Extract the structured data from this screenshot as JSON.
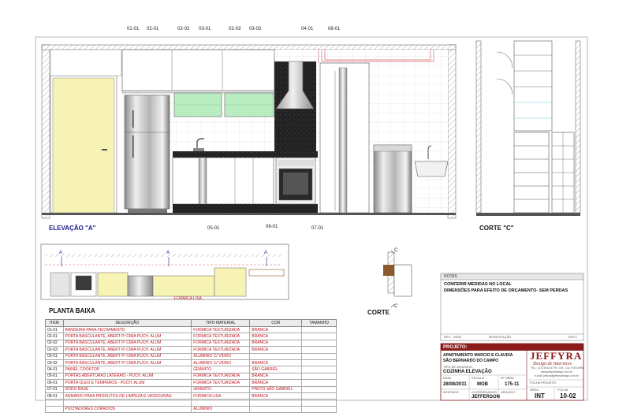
{
  "sheet": {
    "tags_top": [
      "01-01",
      "02-01",
      "02-02",
      "03-01",
      "02-03",
      "03-02",
      "04-01",
      "08-01"
    ],
    "tags_bottom": [
      "05-01",
      "06-01",
      "07-01"
    ],
    "corte_a_marks": [
      "A",
      "A",
      "A"
    ],
    "corte_c_marks": [
      "C",
      "C"
    ]
  },
  "views": {
    "elevation_a": "ELEVAÇÃO \"A\"",
    "corte_c": "CORTE \"C\"",
    "planta_baixa": "PLANTA BAIXA",
    "corte": "CORTE",
    "plan_label": "FORMICA LISA"
  },
  "materials_table": {
    "headers": [
      "ITEM",
      "DESCRIÇÃO",
      "TIPO MATERIAL",
      "COR",
      "TAMANHO"
    ],
    "rows": [
      [
        "01-01",
        "BANDEIRA PARA FECHAMENTO",
        "FORMICA TEXTURIZADA",
        "BRANCA",
        ""
      ],
      [
        "02-01",
        "PORTA BASCULANTE, ABERT P/ CIMA PUCH. ALUM",
        "FORMICA TEXTURIZADA",
        "BRANCA",
        ""
      ],
      [
        "02-02",
        "PORTA BASCULANTE, ABERT P/ CIMA PUCH. ALUM",
        "FORMICA TEXTURIZADA",
        "BRANCA",
        ""
      ],
      [
        "02-03",
        "PORTA BASCULANTE, ABERT P/ CIMA PUCH. ALUM",
        "FORMICA TEXTURIZADA",
        "BRANCA",
        ""
      ],
      [
        "03-01",
        "PORTA BASCULANTE, ABERT P/ CIMA PUCH. ALUM",
        "ALUMINIO C/ VIDRO",
        "",
        ""
      ],
      [
        "03-02",
        "PORTA BASCULANTE, ABERT P/ CIMA PUCH. ALUM",
        "ALUMINIO C/ VIDRO",
        "BRANCA",
        ""
      ],
      [
        "04-01",
        "PAINEL COOKTOP",
        "GRANITO",
        "SÃO GABRIEL",
        ""
      ],
      [
        "05-01",
        "PORTAS ABERTURAS LATERAIS - PUCH. ALUM",
        "FORMICA TEXTURIZADA",
        "BRANCA",
        ""
      ],
      [
        "06-01",
        "PORTA OLEO E TEMPEROS - PUCH. ALUM",
        "FORMICA TEXTURIZADA",
        "BRANCA",
        ""
      ],
      [
        "07-01",
        "RODO BASE",
        "GRANITO",
        "PRETO SÃO GABRIEL",
        ""
      ],
      [
        "08-01",
        "ARMARIO PARA PRODUTOS DE LIMPEZA E VASSOURAS",
        "FORMICA LISA",
        "BRANCA",
        ""
      ],
      [
        "",
        "",
        "",
        "",
        ""
      ],
      [
        "",
        "PUCHADORES CORRIDOS",
        "ALUMINIO",
        "",
        ""
      ]
    ]
  },
  "notes": {
    "header": "NOTAS",
    "lines": [
      "CONFERIR MEDIDAS NO LOCAL",
      "DIMENSÕES PARA EFEITO DE ORÇAMENTO- SEM PERDAS"
    ],
    "revision_headers": [
      "REV",
      "DATA",
      "MODIFICAÇÃO",
      "VISTO"
    ]
  },
  "title_block": {
    "projeto_label": "PROJETO:",
    "client_line1": "APARTAMENTO MARCIO E CLAUDIA",
    "client_line2": "SÃO BERNARDO DO CAMPO",
    "tipo_label": "TIPO DE DESENHO",
    "drawing_title": "COZINHA ELEVAÇÃO",
    "data_label": "DATA",
    "data": "28/08/2011",
    "escala_label": "ESCALA",
    "escala": "MOB",
    "obra_label": "Nº OBRA",
    "obra": "175-11",
    "desenho_label": "DESENHO",
    "coord_label": "COORDENADOR",
    "coord": "JEFFERSON",
    "arquivo_label": "ARQUIVO",
    "folha_projeto_label": "FOLHA PROJETO",
    "area_label": "ÁREA",
    "area": "INT",
    "folha_label": "FOLHA",
    "folha": "10-02",
    "brand_name": "JEFFYRA",
    "brand_tagline": "Design de Interiores",
    "contact_lines": [
      "TEL.: (11) 4044-5776 / Cel.: (11) 9193-5998",
      "www.jeffyradesign.com.br",
      "e-mail: jeffyra@jeffyradesign.com.br"
    ]
  },
  "colors": {
    "brand_red": "#8b1a1a",
    "glass_green": "#b9ecc0",
    "door_yellow": "#f6f3b4",
    "granite": "#222222"
  }
}
